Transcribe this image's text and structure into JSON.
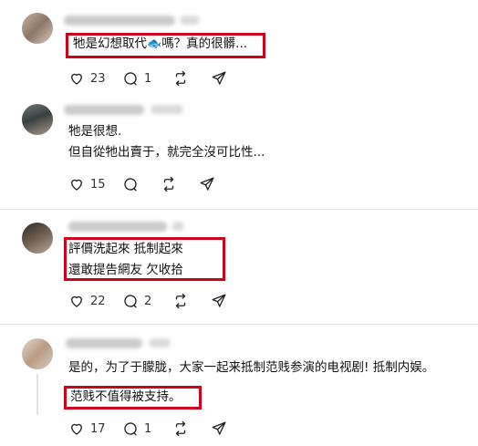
{
  "comments": [
    {
      "text_lines": [
        "牠是幻想取代",
        "嗎？真的很髒..."
      ],
      "emoji": "🐟",
      "likes": "23",
      "replies": "1"
    },
    {
      "text_lines": [
        "牠是很想.",
        "但自從牠出賣于，就完全沒可比性..."
      ],
      "likes": "15",
      "replies": ""
    },
    {
      "text_lines": [
        "評價洗起來 抵制起來",
        "還敢提告網友 欠收拾"
      ],
      "likes": "22",
      "replies": "2"
    },
    {
      "text_lines": [
        "是的，为了于朦胧，大家一起来抵制范贱参演的电视剧! 抵制内娱。",
        "范贱不值得被支持。"
      ],
      "likes": "17",
      "replies": "1"
    }
  ],
  "icons": {
    "like": "heart-icon",
    "reply": "comment-icon",
    "repost": "repost-icon",
    "share": "send-icon"
  },
  "colors": {
    "highlight": "#d0021b"
  }
}
